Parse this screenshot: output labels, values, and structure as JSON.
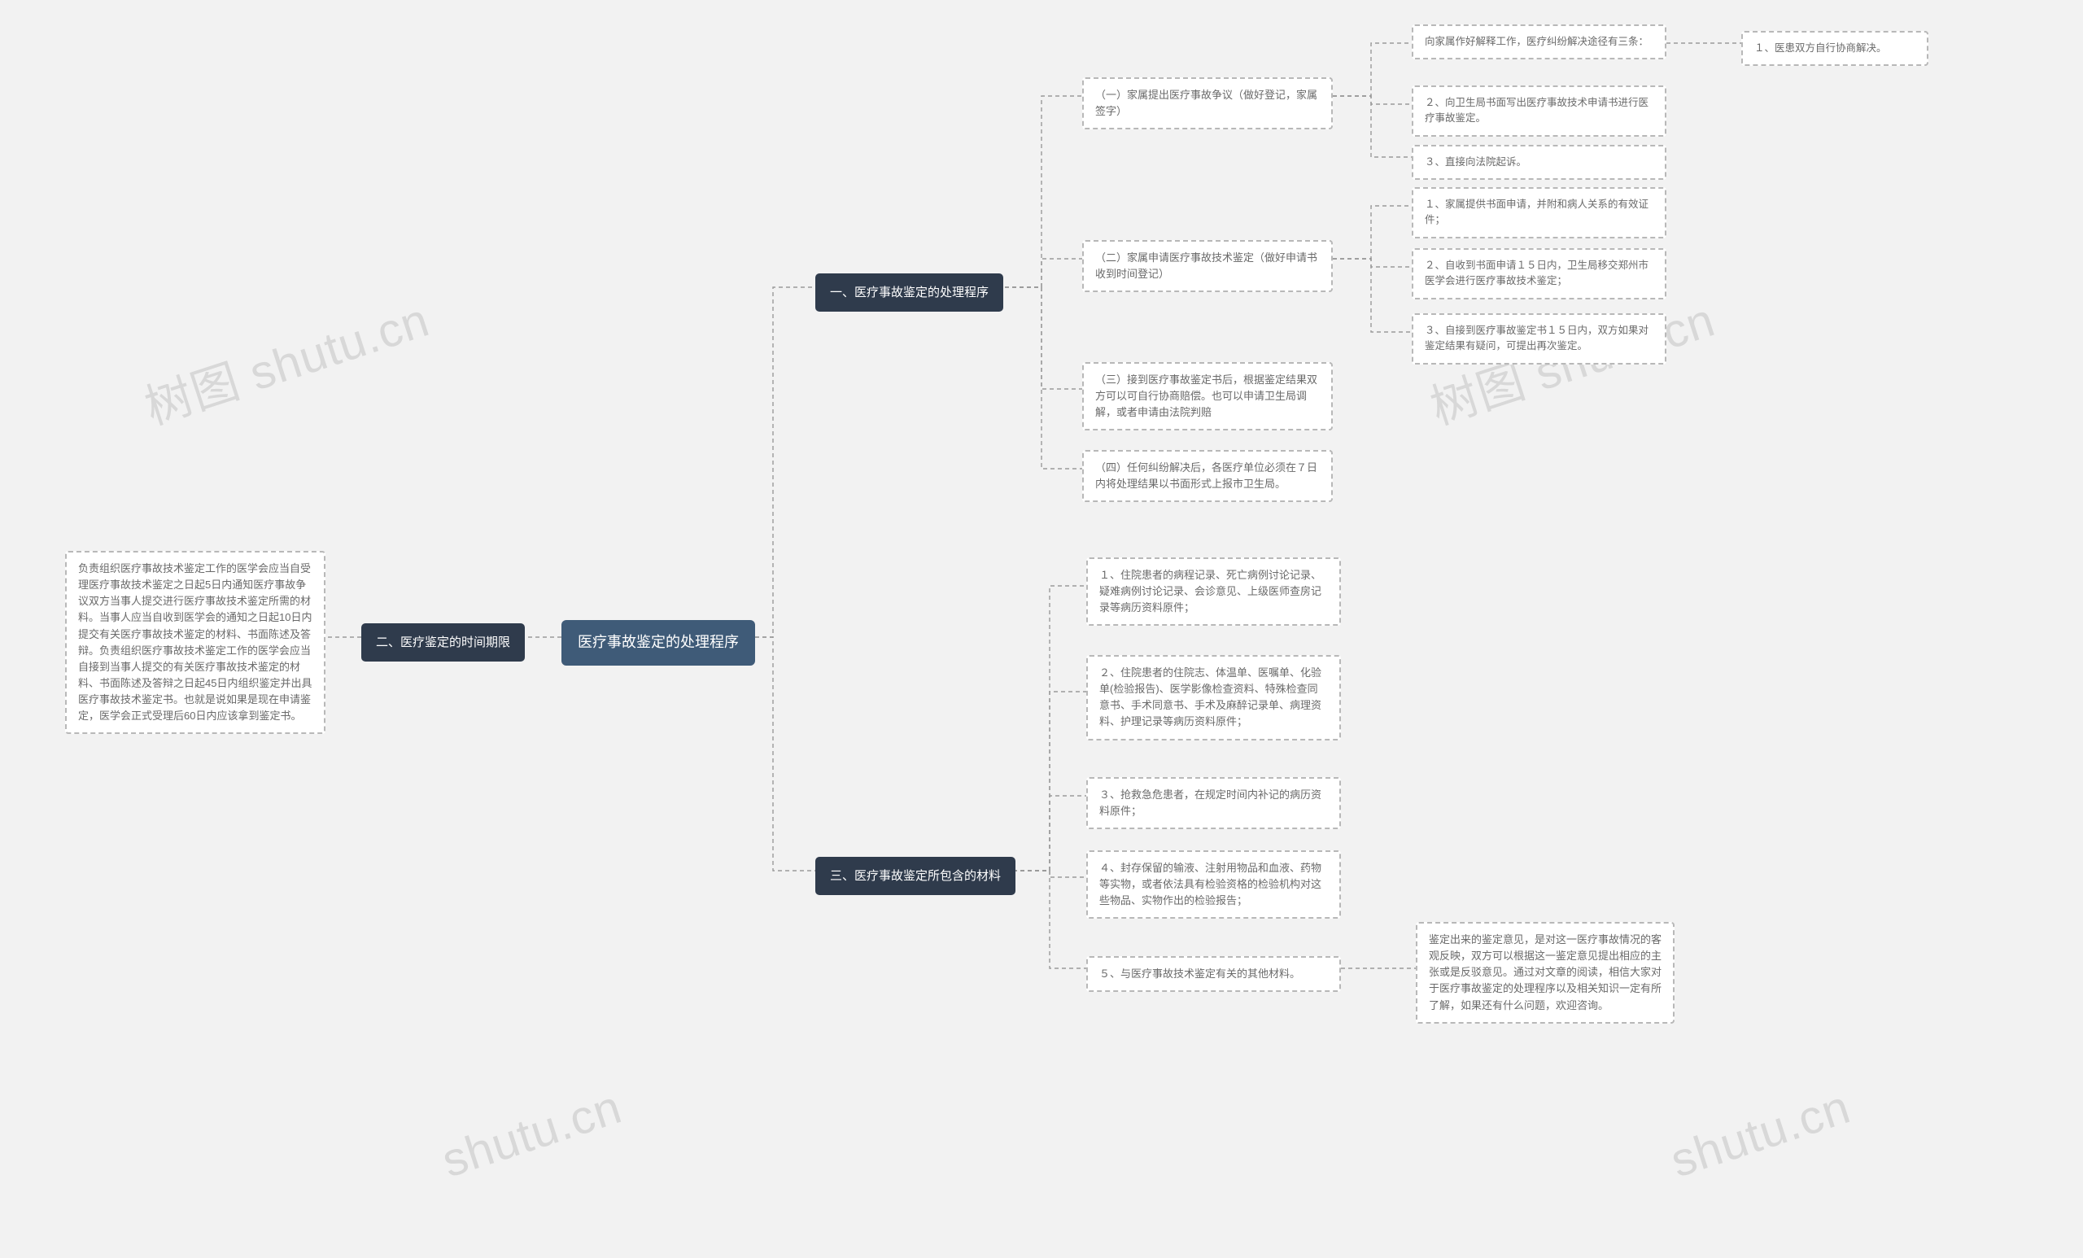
{
  "watermarks": [
    "树图 shutu.cn",
    "树图 shutu.cn",
    "shutu.cn",
    "shutu.cn"
  ],
  "root": {
    "label": "医疗事故鉴定的处理程序"
  },
  "branch_left": {
    "label": "二、医疗鉴定的时间期限"
  },
  "branch_left_leaf": {
    "text": "负责组织医疗事故技术鉴定工作的医学会应当自受理医疗事故技术鉴定之日起5日内通知医疗事故争议双方当事人提交进行医疗事故技术鉴定所需的材料。当事人应当自收到医学会的通知之日起10日内提交有关医疗事故技术鉴定的材料、书面陈述及答辩。负责组织医疗事故技术鉴定工作的医学会应当自接到当事人提交的有关医疗事故技术鉴定的材料、书面陈述及答辩之日起45日内组织鉴定并出具医疗事故技术鉴定书。也就是说如果是现在申请鉴定，医学会正式受理后60日内应该拿到鉴定书。"
  },
  "branch1": {
    "label": "一、医疗事故鉴定的处理程序"
  },
  "branch1_children": {
    "c1": {
      "label": "（一）家属提出医疗事故争议（做好登记，家属签字）"
    },
    "c2": {
      "label": "（二）家属申请医疗事故技术鉴定（做好申请书收到时间登记）"
    },
    "c3": {
      "label": "（三）接到医疗事故鉴定书后，根据鉴定结果双方可以可自行协商赔偿。也可以申请卫生局调解，或者申请由法院判赔"
    },
    "c4": {
      "label": "（四）任何纠纷解决后，各医疗单位必须在７日内将处理结果以书面形式上报市卫生局。"
    }
  },
  "branch1_c1_children": {
    "a1": {
      "label": "向家属作好解释工作，医疗纠纷解决途径有三条："
    },
    "a2": {
      "label": "２、向卫生局书面写出医疗事故技术申请书进行医疗事故鉴定。"
    },
    "a3": {
      "label": "３、直接向法院起诉。"
    }
  },
  "branch1_c1_a1_child": {
    "label": "１、医患双方自行协商解决。"
  },
  "branch1_c2_children": {
    "b1": {
      "label": "１、家属提供书面申请，并附和病人关系的有效证件；"
    },
    "b2": {
      "label": "２、自收到书面申请１５日内，卫生局移交郑州市医学会进行医疗事故技术鉴定；"
    },
    "b3": {
      "label": "３、自接到医疗事故鉴定书１５日内，双方如果对鉴定结果有疑问，可提出再次鉴定。"
    }
  },
  "branch3": {
    "label": "三、医疗事故鉴定所包含的材料"
  },
  "branch3_children": {
    "m1": {
      "label": "１、住院患者的病程记录、死亡病例讨论记录、疑难病例讨论记录、会诊意见、上级医师查房记录等病历资料原件；"
    },
    "m2": {
      "label": "２、住院患者的住院志、体温单、医嘱单、化验单(检验报告)、医学影像检查资料、特殊检查同意书、手术同意书、手术及麻醉记录单、病理资料、护理记录等病历资料原件；"
    },
    "m3": {
      "label": "３、抢救急危患者，在规定时间内补记的病历资料原件；"
    },
    "m4": {
      "label": "４、封存保留的输液、注射用物品和血液、药物等实物，或者依法具有检验资格的检验机构对这些物品、实物作出的检验报告；"
    },
    "m5": {
      "label": "５、与医疗事故技术鉴定有关的其他材料。"
    }
  },
  "branch3_m5_child": {
    "label": "鉴定出来的鉴定意见，是对这一医疗事故情况的客观反映，双方可以根据这一鉴定意见提出相应的主张或是反驳意见。通过对文章的阅读，相信大家对于医疗事故鉴定的处理程序以及相关知识一定有所了解，如果还有什么问题，欢迎咨询。"
  }
}
